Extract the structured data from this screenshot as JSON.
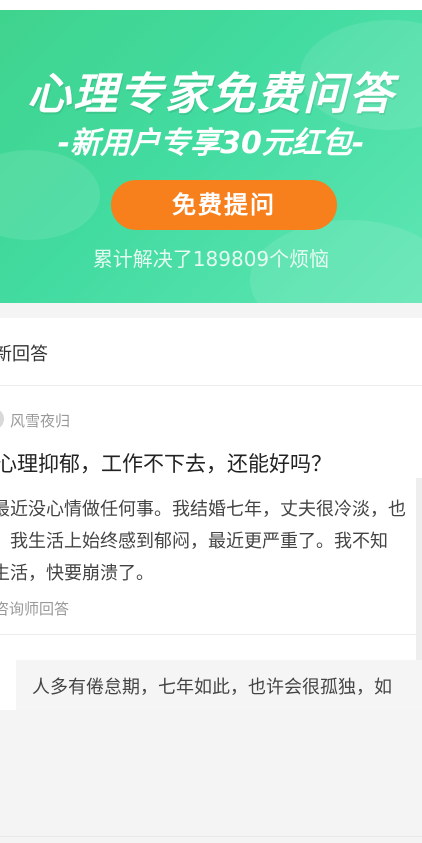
{
  "banner": {
    "title": "心理专家免费问答",
    "subtitle": "-新用户专享30元红包-",
    "cta_label": "免费提问",
    "solved_text": "累计解决了189809个烦恼",
    "colors": {
      "gradient_start": "#3fd38d",
      "gradient_end": "#5fe6b4",
      "cta": "#f77f1c"
    }
  },
  "section": {
    "title": "新回答"
  },
  "question": {
    "username": "风雪夜归",
    "title": "心理抑郁，工作不下去，还能好吗？",
    "body_lines": [
      "最近没心情做任何事。我结婚七年，丈夫很冷淡，也",
      "，我生活上始终感到郁闷，最近更严重了。我不知",
      "生活，快要崩溃了。"
    ],
    "answered_label": "咨询师回答",
    "answer_preview": "人多有倦怠期，七年如此，也许会很孤独，如"
  }
}
